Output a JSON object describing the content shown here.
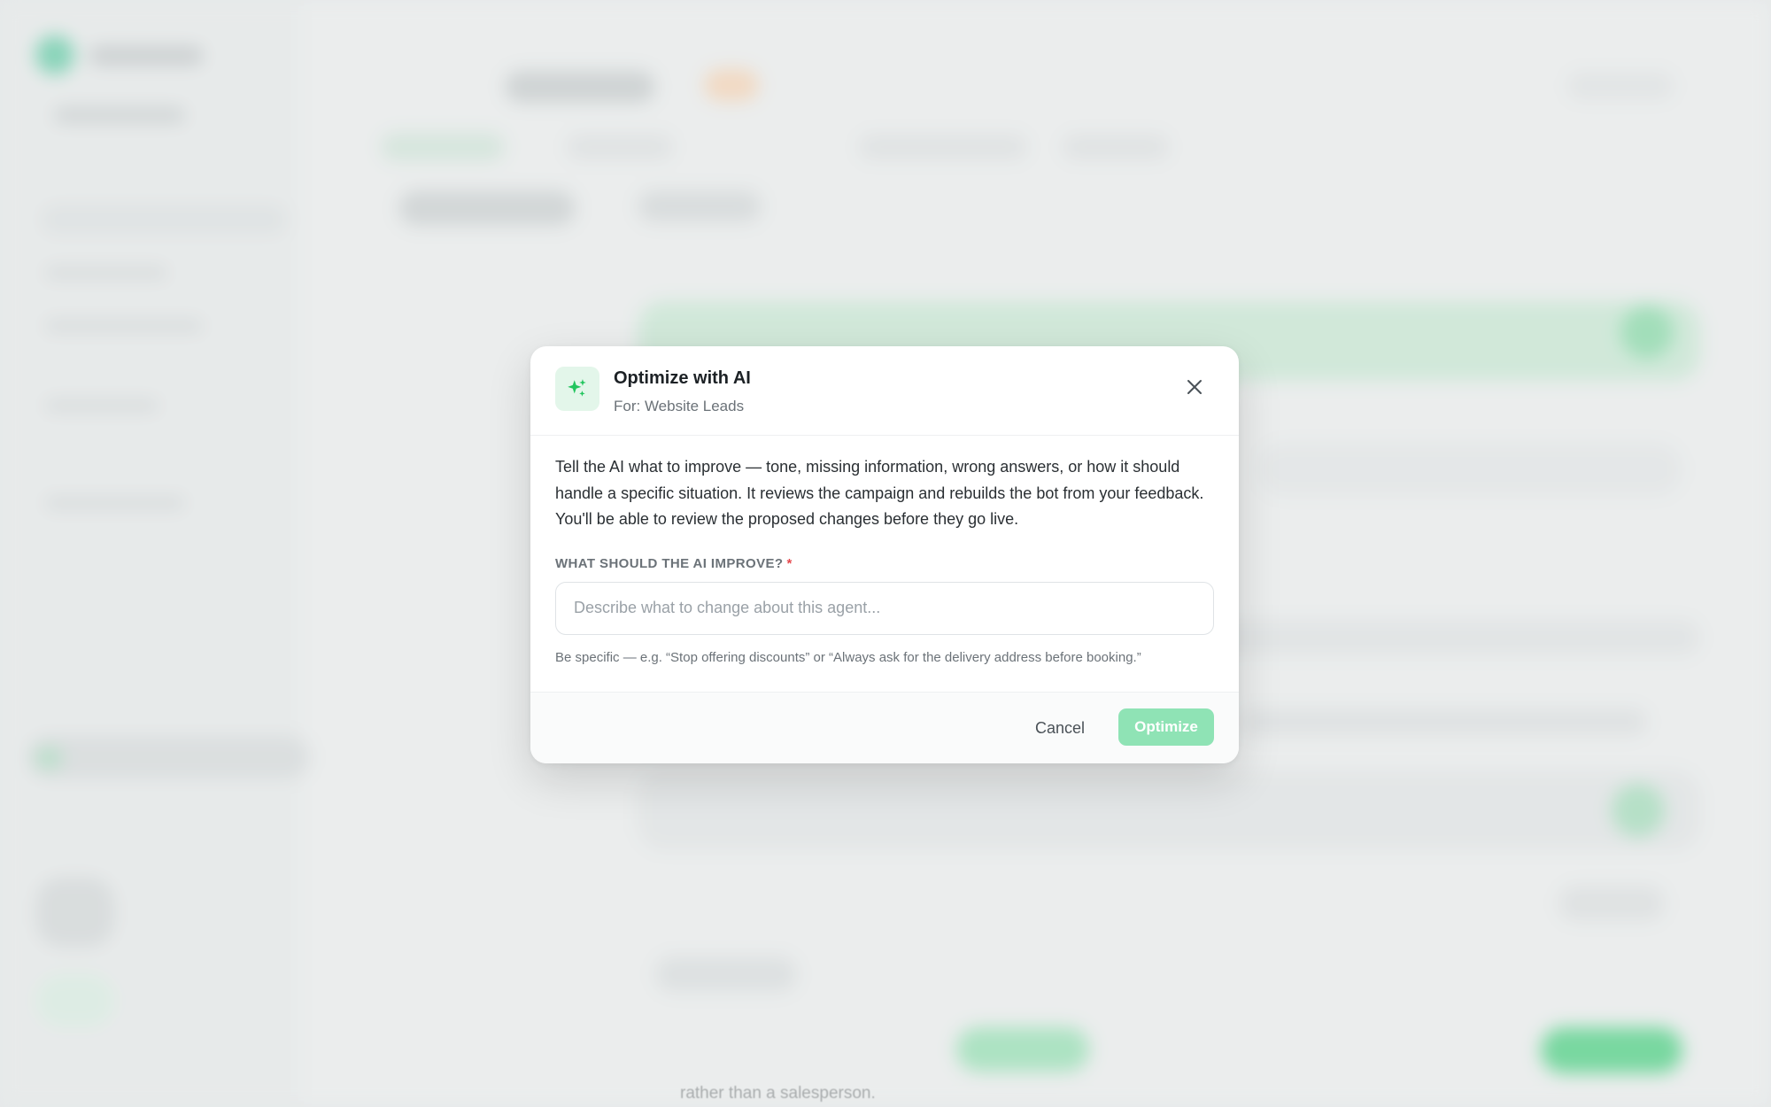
{
  "background": {
    "snippet_text": "rather than a salesperson."
  },
  "modal": {
    "icon": "sparkles-icon",
    "title": "Optimize with AI",
    "subtitle": "For: Website Leads",
    "close_icon": "close-icon",
    "description": "Tell the AI what to improve — tone, missing information, wrong answers, or how it should handle a specific situation. It reviews the campaign and rebuilds the bot from your feedback. You'll be able to review the proposed changes before they go live.",
    "field_label": "WHAT SHOULD THE AI IMPROVE?",
    "required_marker": "*",
    "input_value": "",
    "input_placeholder": "Describe what to change about this agent...",
    "hint": "Be specific — e.g. “Stop offering discounts” or “Always ask for the delivery address before booking.”",
    "cancel_label": "Cancel",
    "optimize_label": "Optimize"
  },
  "colors": {
    "accent": "#22c55e",
    "accent_light": "#8fe3b5",
    "icon_bg": "#e3f6ea",
    "required": "#e5484d"
  }
}
